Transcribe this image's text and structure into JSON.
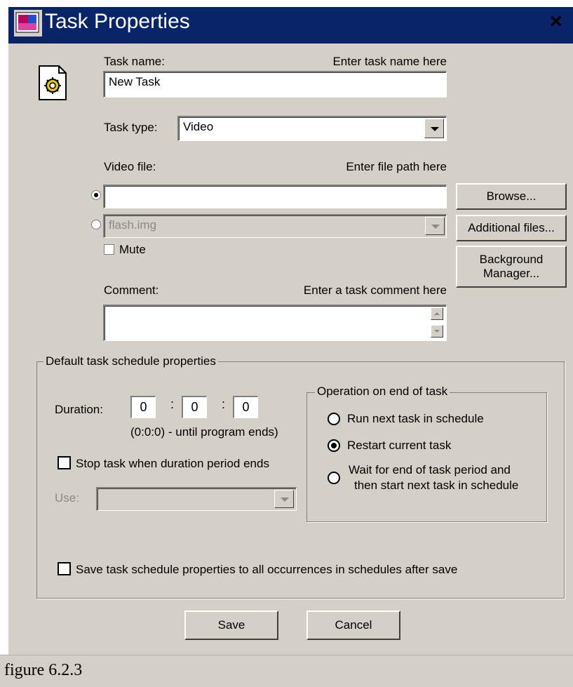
{
  "window": {
    "title": "Task Properties",
    "close": "×"
  },
  "task_name": {
    "label": "Task name:",
    "hint": "Enter task name here",
    "value": "New Task"
  },
  "task_type": {
    "label": "Task type:",
    "value": "Video"
  },
  "video_file": {
    "label": "Video file:",
    "hint": "Enter file path here",
    "path_value": "",
    "flash_value": "flash.img",
    "selected": "path"
  },
  "mute": {
    "label": "Mute",
    "checked": false
  },
  "buttons": {
    "browse": "Browse...",
    "additional": "Additional files...",
    "background_line1": "Background",
    "background_line2": "Manager...",
    "save": "Save",
    "cancel": "Cancel"
  },
  "comment": {
    "label": "Comment:",
    "hint": "Enter a task comment here",
    "value": ""
  },
  "schedule": {
    "group_title": "Default task schedule properties",
    "duration_label": "Duration:",
    "h": "0",
    "sep1": ":",
    "m": "0",
    "sep2": ":",
    "s": "0",
    "duration_note": "(0:0:0) - until program ends)",
    "stop_label": "Stop task when duration period ends",
    "use_label": "Use:",
    "save_all_label": "Save task schedule properties to all occurrences in schedules after save"
  },
  "operation": {
    "group_title": "Operation on end of task",
    "options": [
      {
        "label": "Run next task in schedule",
        "selected": false
      },
      {
        "label": "Restart current task",
        "selected": true
      },
      {
        "label_line1": "Wait for end of task period and",
        "label_line2": "then start next task in schedule",
        "selected": false
      }
    ]
  },
  "caption": "figure 6.2.3",
  "colors": {
    "titlebar": "#0a246a",
    "face": "#d4d0c8"
  }
}
